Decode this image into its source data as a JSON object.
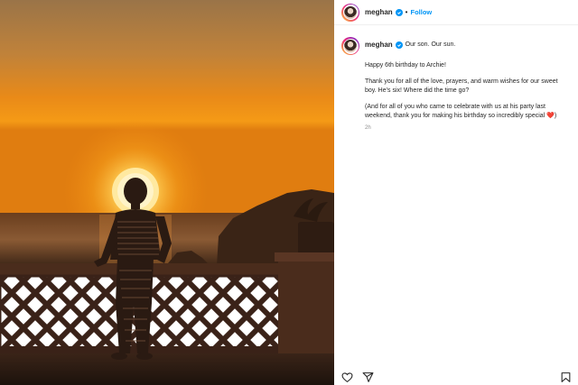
{
  "header": {
    "username": "meghan",
    "separator": "•",
    "follow_label": "Follow",
    "verified_color": "#0095f6"
  },
  "caption": {
    "username": "meghan",
    "title": "Our son. Our sun.",
    "paragraphs": [
      "Happy 6th birthday to Archie!",
      "Thank you for all of the love, prayers, and warm wishes for our sweet boy. He’s six! Where did the time go?",
      "(And for all of you who came to celebrate with us at his party last weekend, thank you for making his birthday so incredibly special"
    ],
    "heart": "❤️",
    "closing": ")",
    "time_ago": "2h"
  },
  "actions": {
    "icons": [
      "heart-icon",
      "share-icon",
      "bookmark-icon"
    ]
  },
  "photo": {
    "description_colors": {
      "sky_top": "#a97a4a",
      "sky_glow": "#f08a12",
      "sun": "#ffe08a",
      "silhouette": "#2a1a12"
    }
  }
}
